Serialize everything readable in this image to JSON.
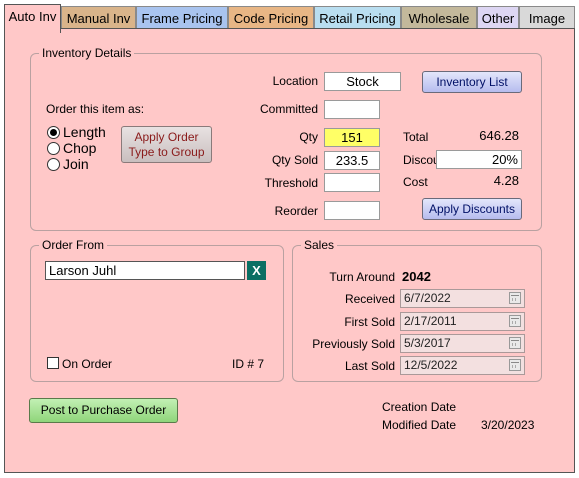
{
  "tabs": [
    {
      "label": "Auto Inv",
      "color": "#ffc8c8"
    },
    {
      "label": "Manual Inv",
      "color": "#d9b48a"
    },
    {
      "label": "Frame Pricing",
      "color": "#a9c4ef"
    },
    {
      "label": "Code Pricing",
      "color": "#e8b685"
    },
    {
      "label": "Retail Pricing",
      "color": "#b9def0"
    },
    {
      "label": "Wholesale",
      "color": "#c3b89b"
    },
    {
      "label": "Other",
      "color": "#ddd6f3"
    },
    {
      "label": "Image",
      "color": "#d9d9d9"
    }
  ],
  "inventory": {
    "title": "Inventory Details",
    "location_label": "Location",
    "location_value": "Stock",
    "inventory_list_button": "Inventory List",
    "order_as_label": "Order this item as:",
    "committed_label": "Committed",
    "committed_value": "",
    "options": [
      "Length",
      "Chop",
      "Join"
    ],
    "selected_option": "Length",
    "apply_order_button_line1": "Apply Order",
    "apply_order_button_line2": "Type to Group",
    "qty_label": "Qty",
    "qty_value": "151",
    "qty_sold_label": "Qty Sold",
    "qty_sold_value": "233.5",
    "threshold_label": "Threshold",
    "threshold_value": "",
    "reorder_label": "Reorder",
    "reorder_value": "",
    "total_label": "Total",
    "total_value": "646.28",
    "discount_label": "Discount",
    "discount_value": "20%",
    "cost_label": "Cost",
    "cost_value": "4.28",
    "apply_discounts_button": "Apply Discounts"
  },
  "order_from": {
    "title": "Order From",
    "vendor_value": "Larson Juhl",
    "clear_button": "X",
    "on_order_label": "On Order",
    "on_order_checked": false,
    "id_text": "ID # 7"
  },
  "sales": {
    "title": "Sales",
    "turn_around_label": "Turn Around",
    "turn_around_value": "2042",
    "received_label": "Received",
    "received_value": "6/7/2022",
    "first_sold_label": "First Sold",
    "first_sold_value": "2/17/2011",
    "previously_sold_label": "Previously Sold",
    "previously_sold_value": "5/3/2017",
    "last_sold_label": "Last Sold",
    "last_sold_value": "12/5/2022"
  },
  "footer": {
    "post_po_button": "Post to Purchase Order",
    "creation_date_label": "Creation Date",
    "creation_date_value": "",
    "modified_date_label": "Modified Date",
    "modified_date_value": "3/20/2023"
  }
}
